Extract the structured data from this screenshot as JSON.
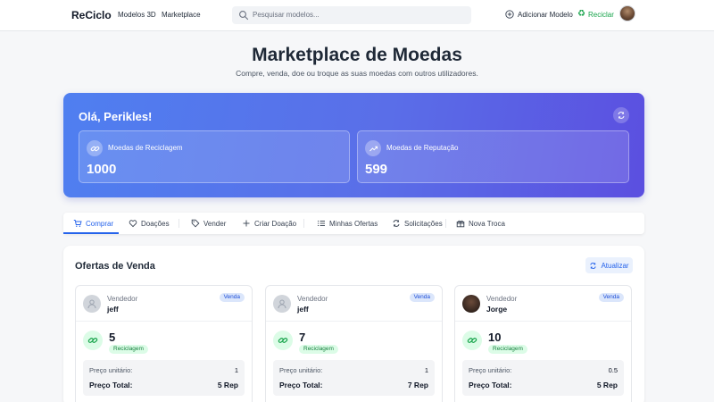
{
  "nav": {
    "brand": "ReCiclo",
    "links": [
      "Modelos 3D",
      "Marketplace"
    ],
    "search_placeholder": "Pesquisar modelos...",
    "add_model": "Adicionar Modelo",
    "recycle": "Reciclar"
  },
  "header": {
    "title": "Marketplace de Moedas",
    "subtitle": "Compre, venda, doe ou troque as suas moedas com outros utilizadores."
  },
  "hero": {
    "greeting": "Olá, Perikles!",
    "balances": [
      {
        "label": "Moedas de Reciclagem",
        "value": "1000"
      },
      {
        "label": "Moedas de Reputação",
        "value": "599"
      }
    ]
  },
  "tabs": [
    "Comprar",
    "Doações",
    "Vender",
    "Criar Doação",
    "Minhas Ofertas",
    "Solicitações",
    "Nova Troca"
  ],
  "offers": {
    "title": "Ofertas de Venda",
    "refresh_label": "Atualizar",
    "seller_label": "Vendedor",
    "badge": "Venda",
    "unit_price_label": "Preço unitário:",
    "total_price_label": "Preço Total:",
    "cards": [
      {
        "seller": "jeff",
        "quantity": "5",
        "coin_type": "Reciclagem",
        "unit_price": "1",
        "total_price": "5 Rep"
      },
      {
        "seller": "jeff",
        "quantity": "7",
        "coin_type": "Reciclagem",
        "unit_price": "1",
        "total_price": "7 Rep"
      },
      {
        "seller": "Jorge",
        "quantity": "10",
        "coin_type": "Reciclagem",
        "unit_price": "0.5",
        "total_price": "5 Rep"
      }
    ]
  },
  "colors": {
    "accent": "#2563eb",
    "hero_start": "#4f7ff0",
    "hero_end": "#5b4fe0",
    "recycle_green": "#16a34a"
  }
}
